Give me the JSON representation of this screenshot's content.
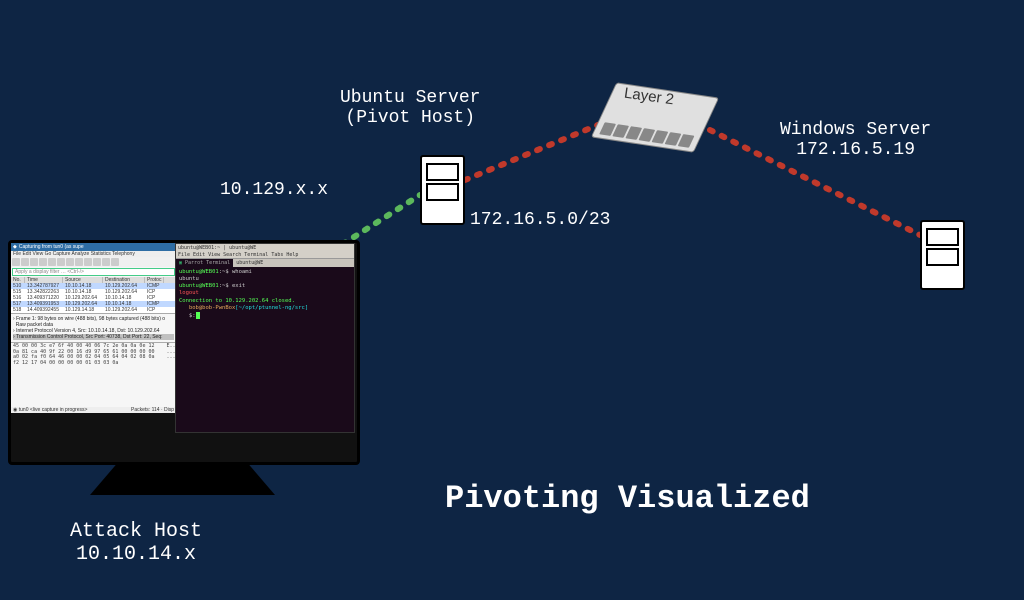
{
  "title": "Pivoting Visualized",
  "attack_host": {
    "label": "Attack Host",
    "ip": "10.10.14.x"
  },
  "ubuntu": {
    "label": "Ubuntu Server",
    "subtitle": "(Pivot Host)",
    "ip": "10.129.x.x"
  },
  "subnet": "172.16.5.0/23",
  "switch": {
    "label": "Layer 2"
  },
  "windows": {
    "label": "Windows Server",
    "ip": "172.16.5.19"
  },
  "wireshark": {
    "title": "Capturing from tun0 (as supe",
    "menu": "File Edit View Go Capture Analyze Statistics Telephony",
    "filter_placeholder": "Apply a display filter … <Ctrl-/>",
    "columns": [
      "No.",
      "Time",
      "Source",
      "Destination",
      "Protoc"
    ],
    "rows": [
      {
        "no": "510",
        "time": "13.342787927",
        "src": "10.10.14.18",
        "dst": "10.129.202.64",
        "proto": "ICMP"
      },
      {
        "no": "515",
        "time": "13.342822263",
        "src": "10.10.14.18",
        "dst": "10.129.202.64",
        "proto": "ICP"
      },
      {
        "no": "516",
        "time": "13.409371220",
        "src": "10.129.202.64",
        "dst": "10.10.14.18",
        "proto": "ICP"
      },
      {
        "no": "517",
        "time": "13.409391953",
        "src": "10.129.202.64",
        "dst": "10.10.14.18",
        "proto": "ICMP"
      },
      {
        "no": "518",
        "time": "14.409392455",
        "src": "10.129.14.18",
        "dst": "10.129.202.64",
        "proto": "ICP"
      }
    ],
    "detail": [
      "Frame 1: 98 bytes on wire (488 bits), 98 bytes captured (488 bits) o",
      "Raw packet data",
      "Internet Protocol Version 4, Src: 10.10.14.18, Dst: 10.129.202.64",
      "Transmission Control Protocol, Src Port: 40738, Dst Port: 22, Seq:"
    ],
    "hex": [
      "45 00 00 3c e7 6f 40 00 40 06 7c 2e 0a 0a 0e 12    E..<.o@.@",
      "0a 81 ca 40 9f 22 00 16 d9 97 65 61 00 00 00 00    ...@.\"....ea",
      "a0 02 fa f0 64 46 00 00 02 04 05 64 04 02 08 0a    ....dF.....d",
      "f2 12 17 04 00 00 00 00 01 03 03 0a"
    ],
    "status_left": "tun0 <live capture in progress>",
    "status_right": "Packets: 114 · Disp"
  },
  "terminal": {
    "window_tabs": "ubuntu@WEB01:~  |  ubuntu@WE",
    "menu": "File Edit View Search Terminal Tabs Help",
    "tabs": {
      "active": "Parrot Terminal",
      "other": "ubuntu@WE"
    },
    "lines": [
      {
        "type": "prompt",
        "user": "ubuntu@WEB01",
        "path": ":~$",
        "cmd": " whoami"
      },
      {
        "type": "out",
        "text": "ubuntu"
      },
      {
        "type": "prompt",
        "user": "ubuntu@WEB01",
        "path": ":~$",
        "cmd": " exit"
      },
      {
        "type": "red",
        "text": "logout"
      },
      {
        "type": "mixed",
        "pre": "Connection to 10.129.202.64 closed."
      },
      {
        "type": "pwnbox",
        "user": "bob@bob-PwnBox",
        "path": "[~/opt/ptunnel-ng/src]"
      },
      {
        "type": "cursor",
        "text": "$:"
      }
    ]
  }
}
